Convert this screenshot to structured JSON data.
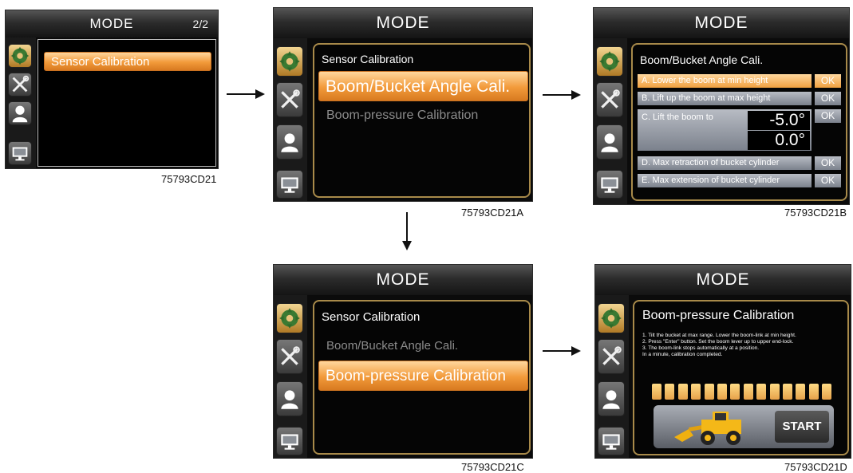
{
  "title": "MODE",
  "page_indicator": "2/2",
  "sidebar_icons": [
    "gear-icon",
    "wrench-screwdriver-icon",
    "user-icon",
    "monitor-icon"
  ],
  "screen1": {
    "menu_item": "Sensor Calibration",
    "caption": "75793CD21"
  },
  "screen2": {
    "panel_title": "Sensor Calibration",
    "items": [
      "Boom/Bucket Angle Cali.",
      "Boom-pressure Calibration"
    ],
    "selected": 0,
    "caption": "75793CD21A"
  },
  "screen3": {
    "panel_title": "Boom/Bucket Angle Cali.",
    "rows": [
      {
        "label": "A. Lower the boom at min height",
        "ok": "OK"
      },
      {
        "label": "B. Lift up the boom at max height",
        "ok": "OK"
      },
      {
        "label": "C. Lift the boom to",
        "ok": "OK"
      },
      {
        "label": "D. Max retraction of bucket cylinder",
        "ok": "OK"
      },
      {
        "label": "E. Max extension of bucket cylinder",
        "ok": "OK"
      }
    ],
    "target_angle": "-5.0°",
    "current_angle": "0.0°",
    "caption": "75793CD21B"
  },
  "screen4": {
    "panel_title": "Sensor Calibration",
    "items": [
      "Boom/Bucket Angle Cali.",
      "Boom-pressure Calibration"
    ],
    "selected": 1,
    "caption": "75793CD21C"
  },
  "screen5": {
    "panel_title": "Boom-pressure Calibration",
    "instructions": [
      "1. Tilt the bucket at max range. Lower the boom-link at min height.",
      "2. Press \"Enter\" button. Set the boom lever up to upper end-lock.",
      "3. The boom-link stops automatically at a position.",
      "    In a minute, calibration completed."
    ],
    "progress_segments": 14,
    "start_label": "START",
    "caption": "75793CD21D"
  },
  "colors": {
    "accent_orange": "#f29a3a",
    "panel_border": "#a88a4a",
    "screen_bg": "#0b0b0b"
  }
}
